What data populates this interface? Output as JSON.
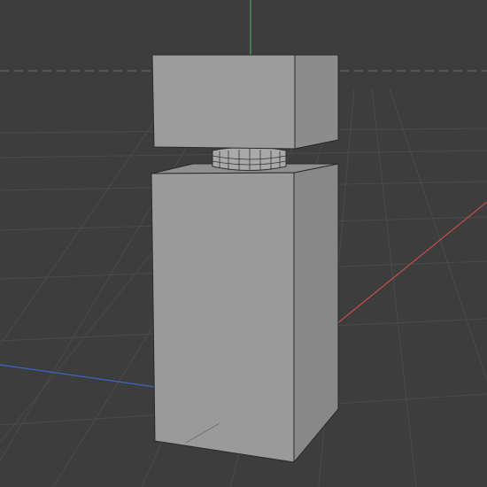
{
  "viewport": {
    "type": "3d-viewport",
    "background_color": "#3d3d3d",
    "grid_visible": true,
    "grid_color": "#4a4a4a",
    "axes": {
      "x_color": "#c64d4d",
      "y_color": "#4aa55a",
      "z_color": "#3d66c2"
    },
    "horizon_line_style": "dashed"
  },
  "scene": {
    "object": {
      "type": "bottle-model",
      "body": {
        "shape": "rectangular-prism",
        "front_color": "#9a9a9a",
        "side_color": "#888888",
        "top_color": "#8f8f8f"
      },
      "cap": {
        "shape": "rectangular-prism",
        "front_color": "#9c9c9c",
        "side_color": "#8c8c8c"
      },
      "neck": {
        "shape": "cylinder",
        "color": "#a9a9a9",
        "edge_color": "#333333",
        "wireframe_segments": 8,
        "wireframe_rings": 3
      }
    }
  }
}
